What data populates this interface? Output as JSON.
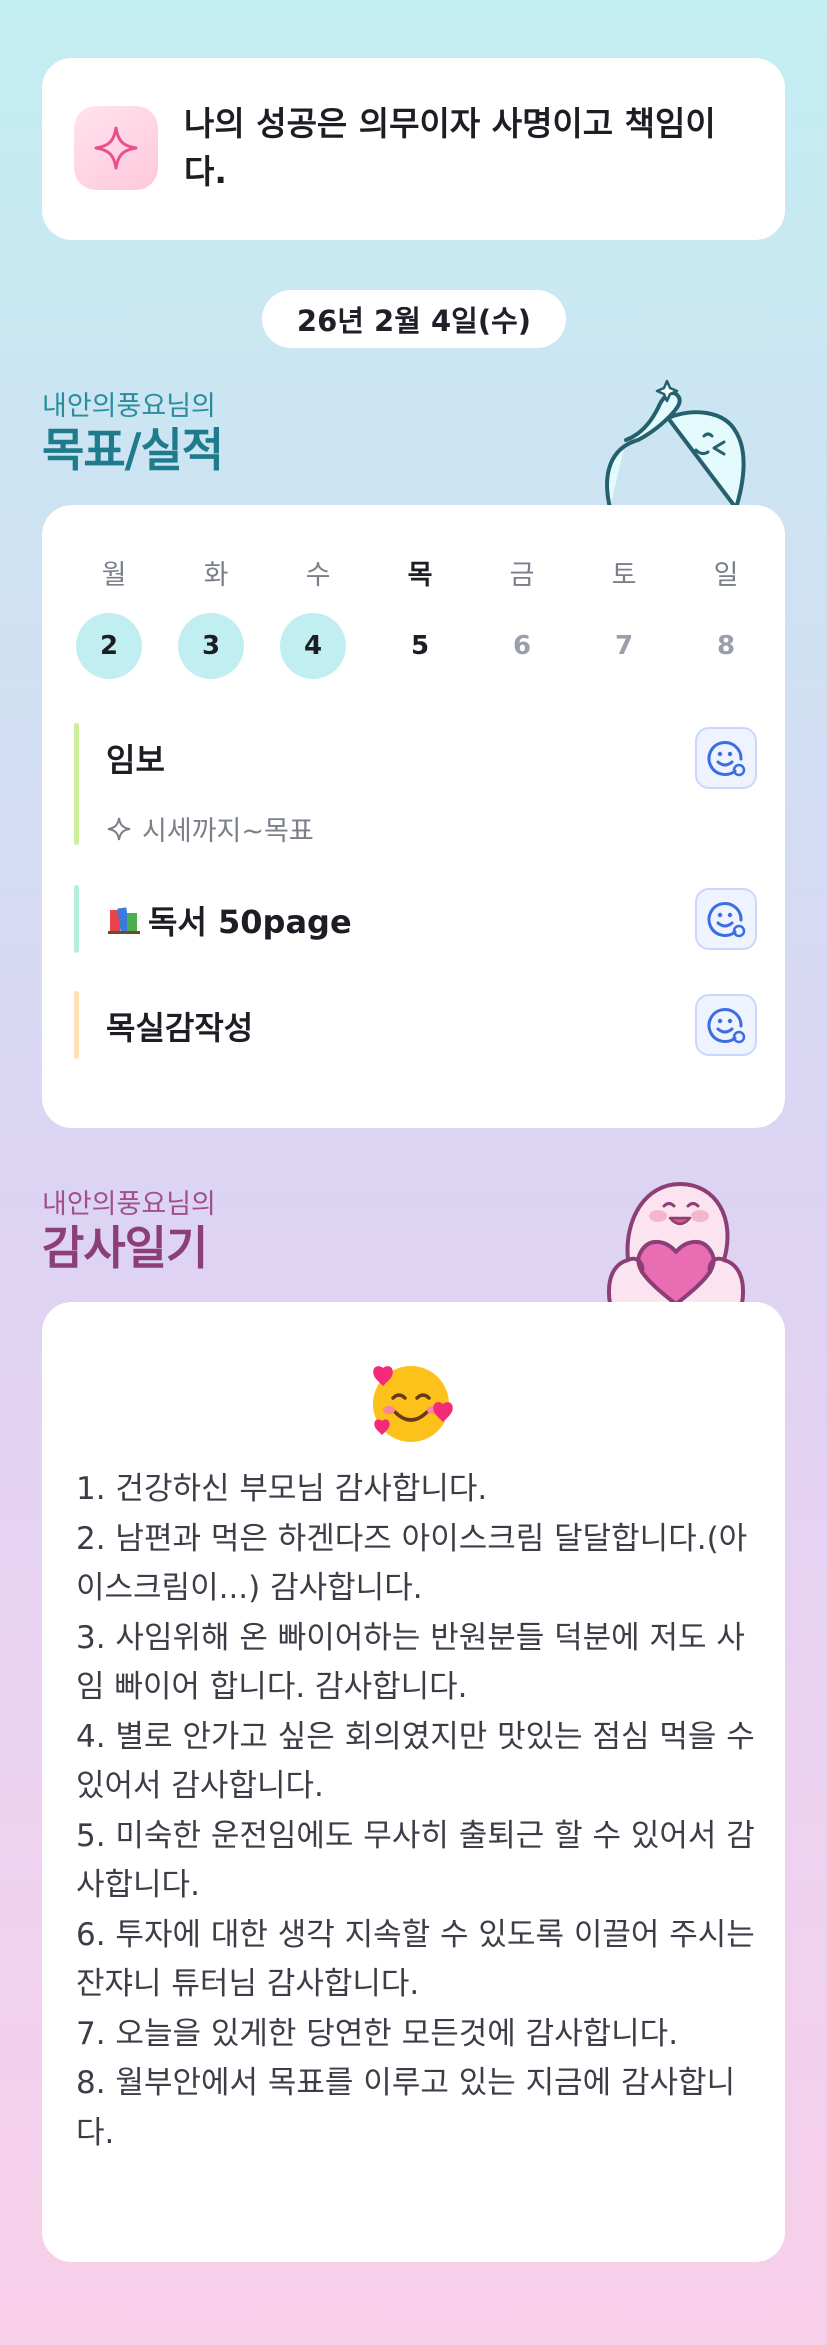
{
  "motto": {
    "text": "나의 성공은 의무이자 사명이고 책임이다.",
    "icon": "sparkle-icon"
  },
  "date": "26년 2월 4일(수)",
  "goals_section": {
    "owner": "내안의풍요님의",
    "title": "목표/실적",
    "title_color": "#1f7a8c"
  },
  "week": {
    "days": [
      "월",
      "화",
      "수",
      "목",
      "금",
      "토",
      "일"
    ],
    "dates": [
      "2",
      "3",
      "4",
      "5",
      "6",
      "7",
      "8"
    ]
  },
  "goals": [
    {
      "title": "임보",
      "subtitle": "시세까지~목표",
      "bar_color": "#cdee9a"
    },
    {
      "title": "독서 50page",
      "icon": "books-icon",
      "bar_color": "#b4efdd"
    },
    {
      "title": "목실감작성",
      "bar_color": "#fde0b4"
    }
  ],
  "gratitude_section": {
    "owner": "내안의풍요님의",
    "title": "감사일기",
    "title_color": "#8c3f76"
  },
  "gratitude": {
    "icon": "smiling-face-with-hearts-icon",
    "items": [
      "1. 건강하신 부모님 감사합니다.",
      "2. 남편과 먹은 하겐다즈 아이스크림 달달합니다.(아이스크림이...) 감사합니다.",
      "3. 사임위해 온 빠이어하는 반원분들 덕분에 저도 사임 빠이어 합니다. 감사합니다.",
      "4. 별로 안가고 싶은 회의였지만 맛있는 점심 먹을 수 있어서 감사합니다.",
      "5. 미숙한 운전임에도 무사히 출퇴근 할 수 있어서 감사합니다.",
      "6. 투자에 대한 생각 지속할 수 있도록 이끌어 주시는 잔쟈니 튜터님 감사합니다.",
      "7. 오늘을 있게한 당연한 모든것에 감사합니다.",
      "8. 월부안에서 목표를 이루고 있는 지금에 감사합니다."
    ]
  }
}
